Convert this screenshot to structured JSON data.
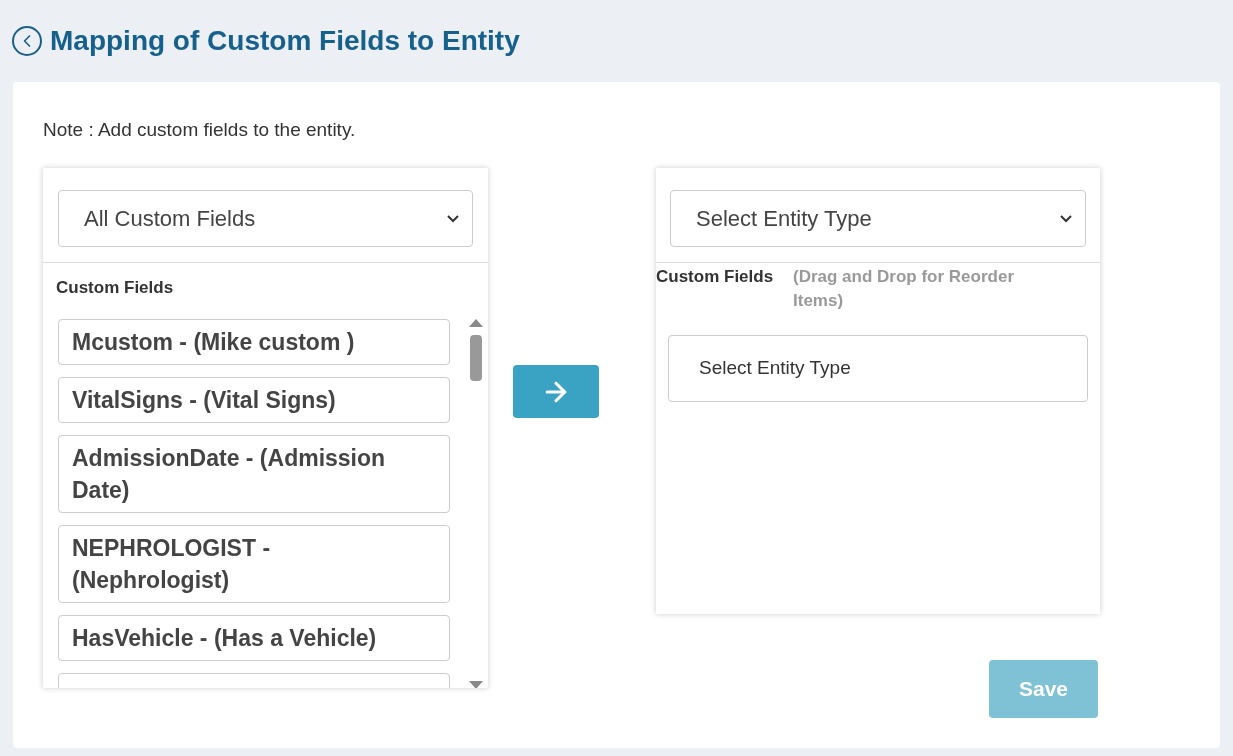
{
  "title": "Mapping of Custom Fields to Entity",
  "note": "Note : Add custom fields to the entity.",
  "left_panel": {
    "dropdown": "All Custom Fields",
    "heading": "Custom Fields",
    "items": [
      {
        "label": "Mcustom - (Mike custom )"
      },
      {
        "label": "VitalSigns - (Vital Signs)"
      },
      {
        "label": "AdmissionDate - (Admission Date)"
      },
      {
        "label": "NEPHROLOGIST - (Nephrologist)"
      },
      {
        "label": "HasVehicle - (Has a Vehicle)"
      }
    ]
  },
  "right_panel": {
    "dropdown": "Select Entity Type",
    "heading": "Custom Fields",
    "hint": "(Drag and Drop for Reorder Items)",
    "items": [
      {
        "label": "Select Entity Type"
      }
    ]
  },
  "save_button": {
    "label": "Save",
    "disabled": true
  }
}
